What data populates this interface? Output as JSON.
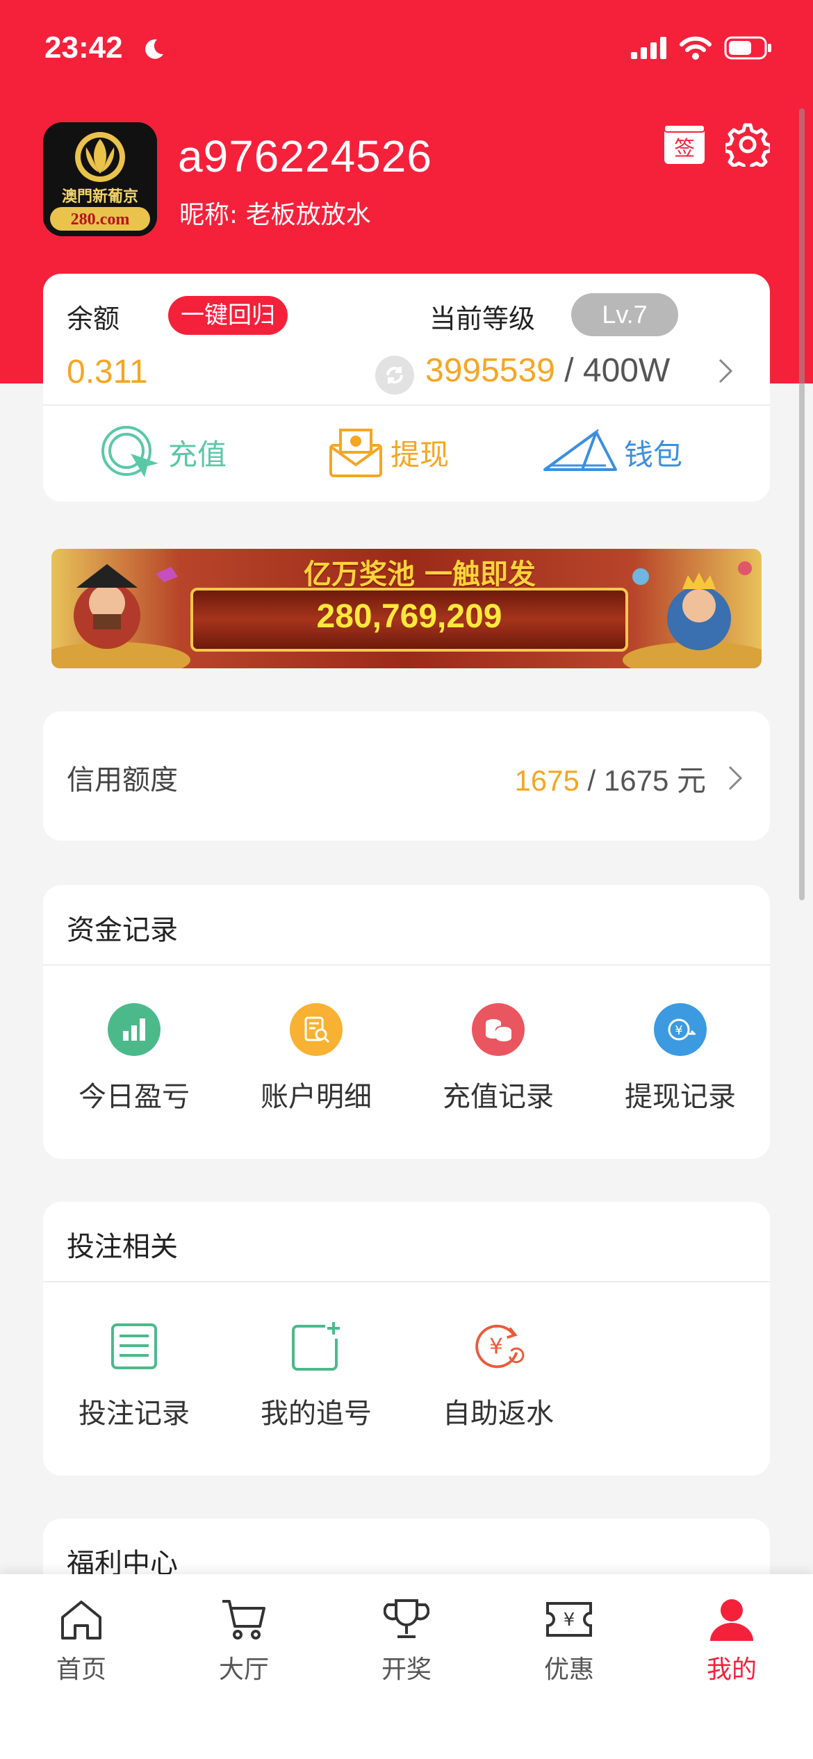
{
  "status_bar": {
    "time": "23:42"
  },
  "header": {
    "avatar_logo_text": "澳門新葡京",
    "avatar_logo_domain": "280.com",
    "username": "a976224526",
    "nickname": "昵称: 老板放放水",
    "sign_label": "签"
  },
  "balance": {
    "label": "余额",
    "one_key_return": "一键回归",
    "value": "0.311",
    "level_label": "当前等级",
    "level": "Lv.7",
    "points": "3995539",
    "points_sep": " / ",
    "points_target": "400W"
  },
  "actions": [
    {
      "label": "充值",
      "icon": "recharge-icon"
    },
    {
      "label": "提现",
      "icon": "withdraw-icon"
    },
    {
      "label": "钱包",
      "icon": "wallet-icon"
    }
  ],
  "banner": {
    "headline": "亿万奖池 一触即发",
    "jackpot": "280,769,209"
  },
  "credit": {
    "label": "信用额度",
    "current": "1675",
    "sep": " / ",
    "total": "1675 元"
  },
  "funds_section": {
    "title": "资金记录",
    "items": [
      {
        "label": "今日盈亏",
        "icon": "chart-icon",
        "color": "#4cb98b"
      },
      {
        "label": "账户明细",
        "icon": "document-search-icon",
        "color": "#f8b133"
      },
      {
        "label": "充值记录",
        "icon": "coins-icon",
        "color": "#ea5660"
      },
      {
        "label": "提现记录",
        "icon": "yen-transfer-icon",
        "color": "#3c9ae0"
      }
    ]
  },
  "bet_section": {
    "title": "投注相关",
    "items": [
      {
        "label": "投注记录",
        "icon": "list-icon",
        "color": "#4cb98b"
      },
      {
        "label": "我的追号",
        "icon": "add-square-icon",
        "color": "#4cb98b"
      },
      {
        "label": "自助返水",
        "icon": "yen-refresh-icon",
        "color": "#ea5a3c"
      }
    ]
  },
  "welfare_section": {
    "title": "福利中心"
  },
  "tabbar": [
    {
      "label": "首页",
      "icon": "home-icon"
    },
    {
      "label": "大厅",
      "icon": "cart-icon"
    },
    {
      "label": "开奖",
      "icon": "trophy-icon"
    },
    {
      "label": "优惠",
      "icon": "ticket-icon"
    },
    {
      "label": "我的",
      "icon": "user-icon",
      "active": true
    }
  ],
  "colors": {
    "brand_red": "#f5213b",
    "accent_orange": "#f5a623"
  }
}
